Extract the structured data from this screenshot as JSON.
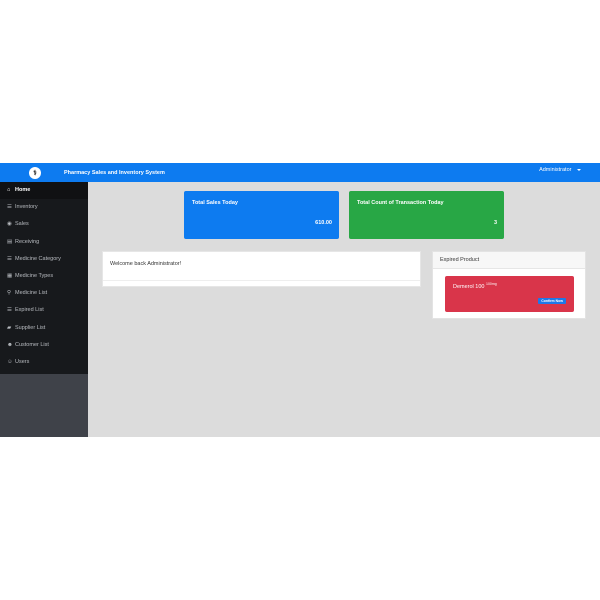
{
  "topbar": {
    "brand_title": "Pharmacy Sales and Inventory System",
    "user_label": "Administrator"
  },
  "sidebar": {
    "items": [
      {
        "label": "Home",
        "icon": "home-icon"
      },
      {
        "label": "Inventory",
        "icon": "list-icon"
      },
      {
        "label": "Sales",
        "icon": "coins-icon"
      },
      {
        "label": "Receiving",
        "icon": "file-icon"
      },
      {
        "label": "Medicine Category",
        "icon": "list-icon"
      },
      {
        "label": "Medicine Types",
        "icon": "table-icon"
      },
      {
        "label": "Medicine List",
        "icon": "sitemap-icon"
      },
      {
        "label": "Expired List",
        "icon": "list-icon"
      },
      {
        "label": "Supplier List",
        "icon": "truck-icon"
      },
      {
        "label": "Customer List",
        "icon": "users-icon"
      },
      {
        "label": "Users",
        "icon": "user-icon"
      }
    ]
  },
  "cards": {
    "sales_title": "Total Sales Today",
    "sales_value": "610.00",
    "transactions_title": "Total Count of Transaction Today",
    "transactions_value": "3"
  },
  "welcome": {
    "message": "Welcome back Administrator!"
  },
  "expired": {
    "title": "Expired Product",
    "product_name": "Demerol 100",
    "product_unit": "100mg",
    "confirm_label": "Confirm Now"
  },
  "colors": {
    "topbar": "#0d7bf0",
    "sales_card": "#0d7bf0",
    "transactions_card": "#28a745",
    "expired_alert": "#d9354a",
    "sidebar": "#17191c"
  }
}
